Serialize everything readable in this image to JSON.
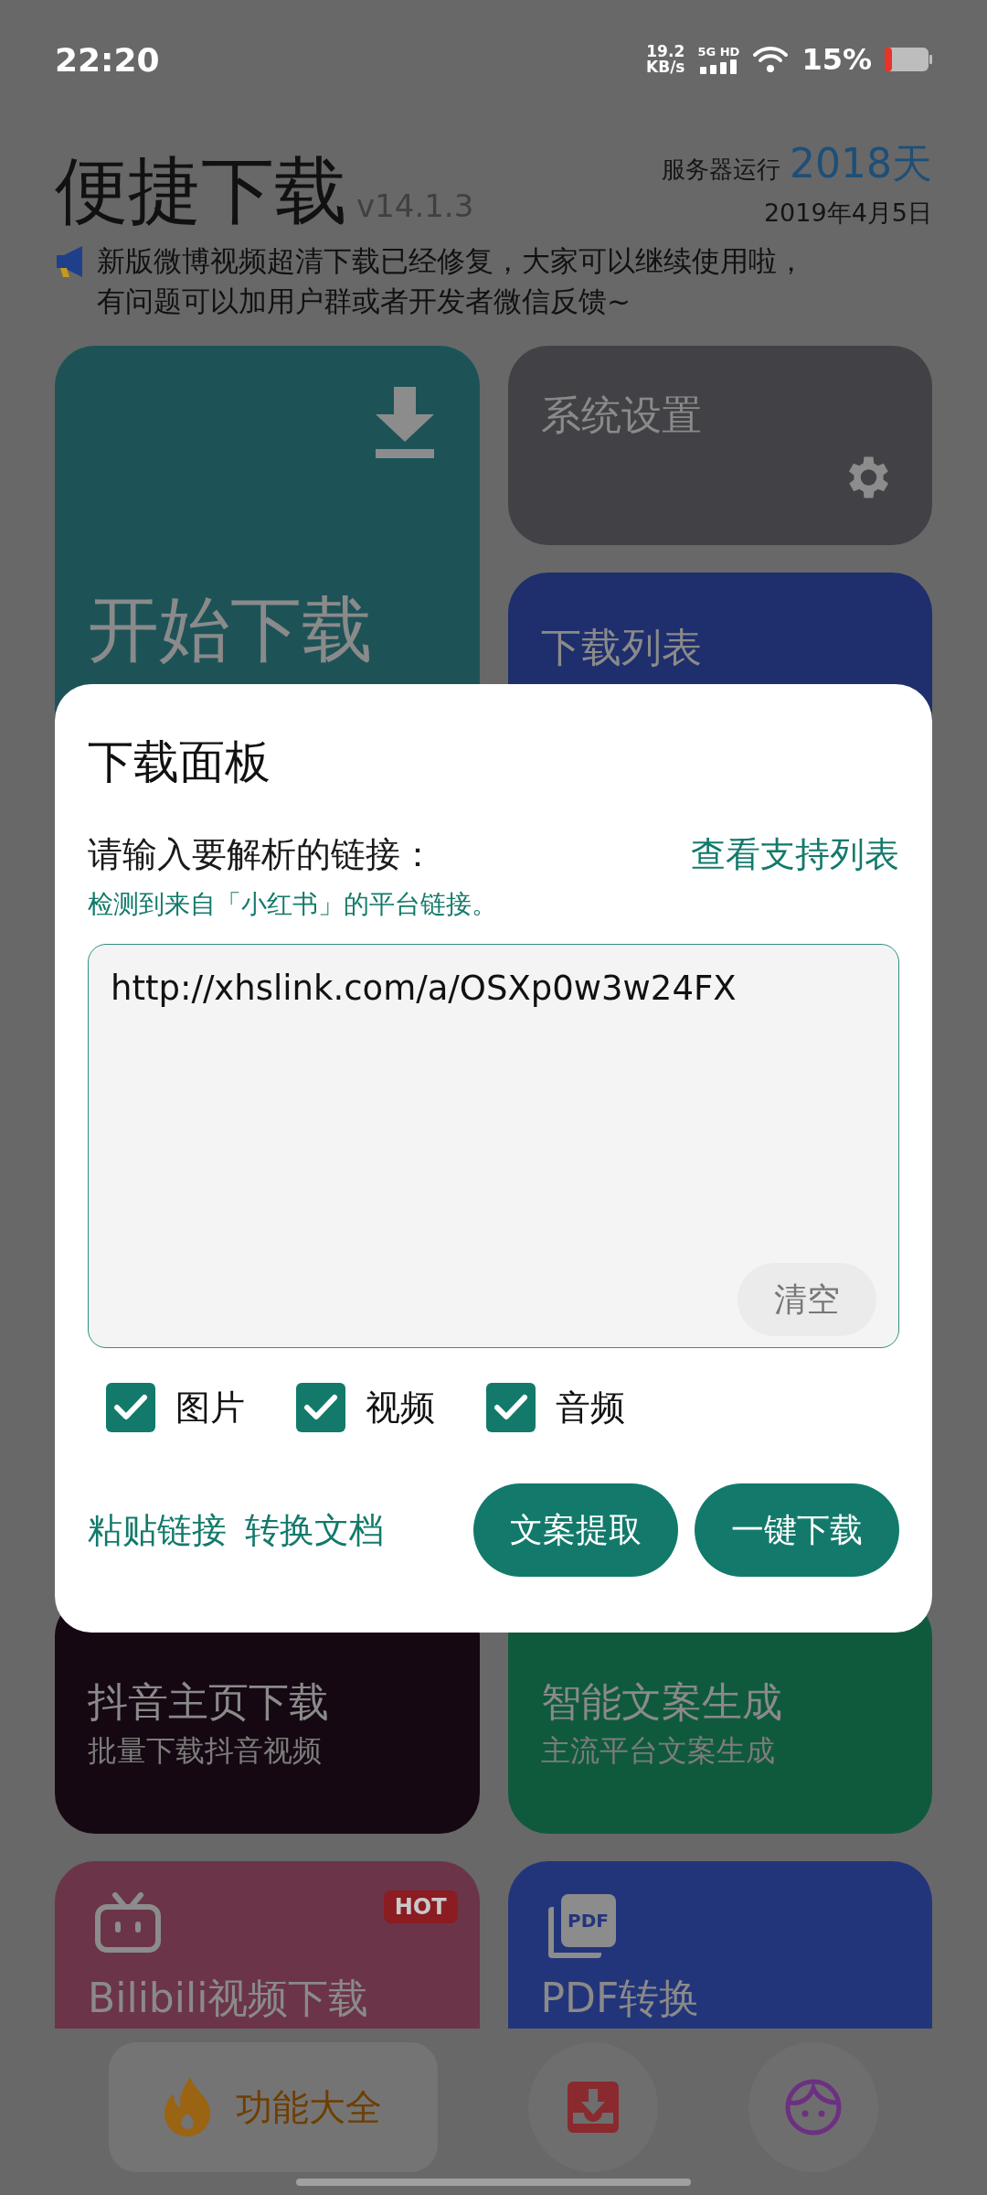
{
  "status_bar": {
    "time": "22:20",
    "net_speed": "19.2",
    "net_unit": "KB/s",
    "network": "5G HD",
    "battery": "15%"
  },
  "header": {
    "title": "便捷下载",
    "version": "v14.1.3",
    "server_label": "服务器运行",
    "server_days": "2018天",
    "date": "2019年4月5日",
    "notice_lines": [
      "新版微博视频超清下载已经修复，大家可以继续使用啦，",
      "有问题可以加用户群或者开发者微信反馈~"
    ]
  },
  "columns": [
    [
      {
        "title": "开始下载",
        "color": "#1d5357",
        "kind": "download"
      },
      {
        "title": "抖音主页下载",
        "subtitle": "批量下载抖音视频",
        "color": "#150812",
        "kind": "plain"
      },
      {
        "title": "Bilibili视频下载",
        "color": "#6c3449",
        "kind": "tv",
        "badge": "HOT"
      }
    ],
    [
      {
        "title": "系统设置",
        "color": "#424246",
        "kind": "gear"
      },
      {
        "title": "下载列表",
        "color": "#1f2e6c",
        "kind": "plain"
      },
      {
        "title": "智能文案生成",
        "subtitle": "主流平台文案生成",
        "color": "#0f5a3d",
        "kind": "plain"
      },
      {
        "title": "PDF转换",
        "color": "#23357a",
        "kind": "pdf",
        "icon_label": "PDF"
      }
    ]
  ],
  "dialog": {
    "title": "下载面板",
    "prompt": "请输入要解析的链接：",
    "support_link": "查看支持列表",
    "detected": "检测到来自「小红书」的平台链接。",
    "url": "http://xhslink.com/a/OSXp0w3w24FX",
    "clear": "清空",
    "options": [
      {
        "label": "图片",
        "checked": true
      },
      {
        "label": "视频",
        "checked": true
      },
      {
        "label": "音频",
        "checked": true
      }
    ],
    "links": [
      "粘贴链接",
      "转换文档"
    ],
    "buttons": [
      "文案提取",
      "一键下载"
    ]
  },
  "nav": [
    {
      "label": "功能大全",
      "kind": "flame",
      "selected": true
    },
    {
      "kind": "inbox",
      "selected": false
    },
    {
      "kind": "face",
      "selected": false
    }
  ]
}
